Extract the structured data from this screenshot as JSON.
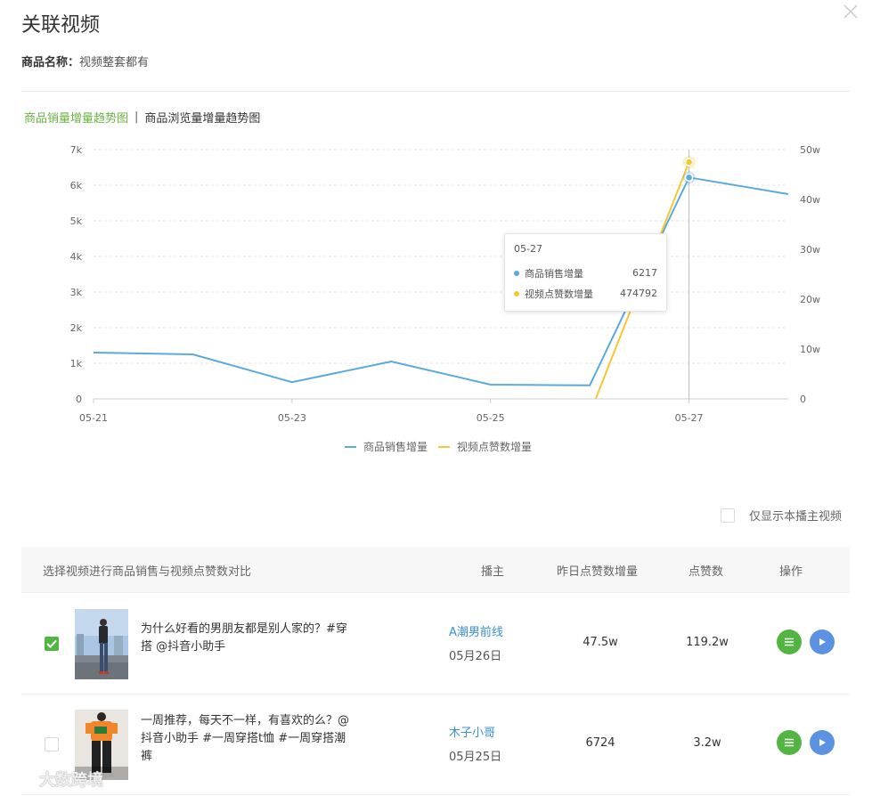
{
  "header": {
    "title": "关联视频",
    "product_label": "商品名称：",
    "product_name": "视频整套都有"
  },
  "tabs": {
    "sales": "商品销量增量趋势图",
    "separator": "|",
    "views": "商品浏览量增量趋势图"
  },
  "chart_data": {
    "type": "line",
    "x": [
      "05-21",
      "05-22",
      "05-23",
      "05-24",
      "05-25",
      "05-26",
      "05-27",
      "05-28"
    ],
    "xticks": [
      "05-21",
      "05-23",
      "05-25",
      "05-27"
    ],
    "y_left_ticks": [
      "0",
      "1k",
      "2k",
      "3k",
      "4k",
      "5k",
      "6k",
      "7k"
    ],
    "y_right_ticks": [
      "0",
      "10w",
      "20w",
      "30w",
      "40w",
      "50w"
    ],
    "y_left_lim": [
      0,
      7000
    ],
    "y_right_lim": [
      0,
      500000
    ],
    "series": [
      {
        "name": "商品销售增量",
        "axis": "left",
        "color": "#5aaadc",
        "values": [
          1300,
          1250,
          470,
          1050,
          400,
          380,
          6217,
          5750
        ]
      },
      {
        "name": "视频点赞数增量",
        "axis": "right",
        "color": "#f5c730",
        "values": [
          null,
          null,
          null,
          null,
          null,
          -30000,
          474792,
          null
        ]
      }
    ],
    "grid": true,
    "legend": "bottom-center",
    "tooltip": {
      "date": "05-27",
      "rows": [
        {
          "name": "商品销售增量",
          "value": "6217",
          "color": "#5aaadc"
        },
        {
          "name": "视频点赞数增量",
          "value": "474792",
          "color": "#f5c730"
        }
      ]
    }
  },
  "legend": {
    "sales": "商品销售增量",
    "likes": "视频点赞数增量"
  },
  "filter": {
    "only_mine_label": "仅显示本播主视频"
  },
  "table": {
    "headers": {
      "compare": "选择视频进行商品销售与视频点赞数对比",
      "author": "播主",
      "yesterday_likes": "昨日点赞数增量",
      "likes": "点赞数",
      "actions": "操作"
    },
    "rows": [
      {
        "checked": true,
        "title": "为什么好看的男朋友都是别人家的？#穿搭 @抖音小助手",
        "author": "A潮男前线",
        "date": "05月26日",
        "yesterday_likes": "47.5w",
        "likes": "119.2w"
      },
      {
        "checked": false,
        "title": "一周推荐，每天不一样，有喜欢的么？@抖音小助手 #一周穿搭t恤 #一周穿搭潮裤",
        "author": "木子小哥",
        "date": "05月25日",
        "yesterday_likes": "6724",
        "likes": "3.2w"
      }
    ]
  },
  "watermark": "大数跨境"
}
